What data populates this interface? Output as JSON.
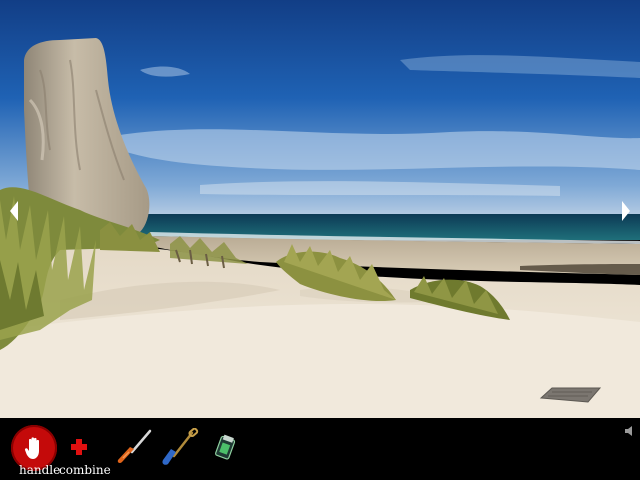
{
  "scene": {
    "name": "beach",
    "sky_color": "#1f5fb0",
    "sea_color": "#0f4860",
    "sand_color": "#efe6d6"
  },
  "navigation": {
    "left_arrow_icon": "arrow-left-icon",
    "right_arrow_icon": "arrow-right-icon"
  },
  "toolbar": {
    "handle_label": "handle",
    "combine_label": "combine",
    "hand_icon": "hand-icon",
    "combine_icon": "red-cross-icon",
    "sound_icon": "speaker-icon"
  },
  "inventory": [
    {
      "item": "screwdriver",
      "icon": "screwdriver-icon"
    },
    {
      "item": "shovel",
      "icon": "shovel-icon"
    },
    {
      "item": "lighter",
      "icon": "lighter-icon"
    }
  ]
}
